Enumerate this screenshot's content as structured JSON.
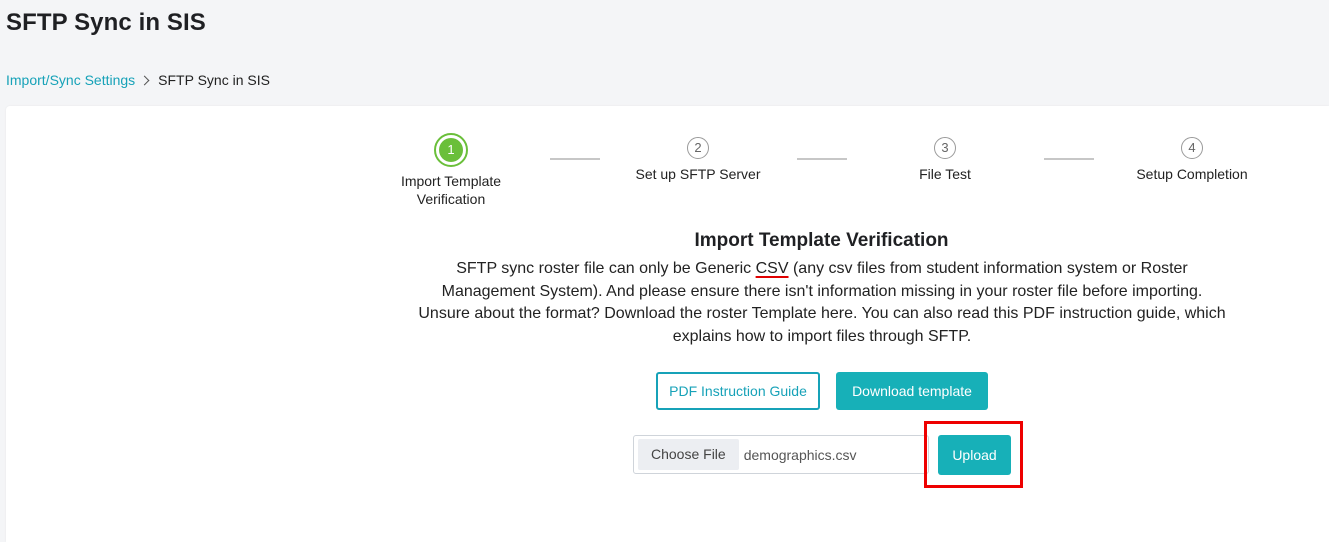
{
  "header": {
    "title": "SFTP Sync in SIS"
  },
  "breadcrumb": {
    "parent": "Import/Sync Settings",
    "current": "SFTP Sync in SIS"
  },
  "stepper": {
    "steps": [
      {
        "number": "1",
        "label_line1": "Import Template",
        "label_line2": "Verification",
        "active": true
      },
      {
        "number": "2",
        "label_line1": "Set up SFTP Server",
        "label_line2": "",
        "active": false
      },
      {
        "number": "3",
        "label_line1": "File Test",
        "label_line2": "",
        "active": false
      },
      {
        "number": "4",
        "label_line1": "Setup Completion",
        "label_line2": "",
        "active": false
      }
    ]
  },
  "section": {
    "title": "Import Template Verification",
    "desc_before": "SFTP sync roster file can only be Generic ",
    "desc_highlight": "CSV",
    "desc_after": " (any csv files from student information system or Roster Management System). And please ensure there isn't information missing in your roster file before importing. Unsure about the format? Download the roster Template here. You can also read this PDF instruction guide, which explains how to import files through SFTP."
  },
  "actions": {
    "pdf_guide_label": "PDF Instruction Guide",
    "download_template_label": "Download template"
  },
  "upload": {
    "choose_file_label": "Choose File",
    "file_name": "demographics.csv",
    "upload_label": "Upload"
  },
  "colors": {
    "accent": "#17b0b8",
    "active_step": "#6abf3a",
    "highlight": "#ee0000"
  }
}
